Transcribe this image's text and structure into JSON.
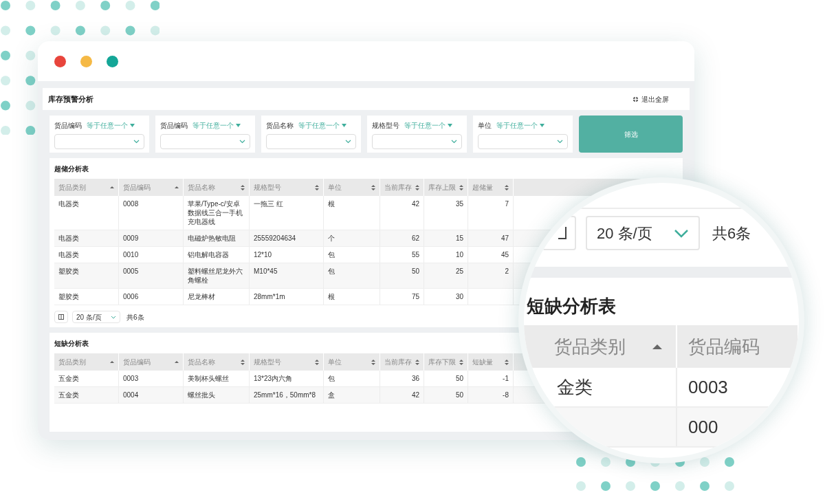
{
  "window": {
    "title": "库存预警分析",
    "exit_fullscreen": "退出全屏"
  },
  "filters": [
    {
      "label": "货品编码",
      "operator": "等于任意一个"
    },
    {
      "label": "货品编码",
      "operator": "等于任意一个"
    },
    {
      "label": "货品名称",
      "operator": "等于任意一个"
    },
    {
      "label": "规格型号",
      "operator": "等于任意一个"
    },
    {
      "label": "单位",
      "operator": "等于任意一个"
    }
  ],
  "filter_button": "筛选",
  "overstock": {
    "title": "超储分析表",
    "columns": [
      {
        "label": "货品类别",
        "sort_ascending": true,
        "kind": "text"
      },
      {
        "label": "货品编码",
        "sort_ascending": true,
        "kind": "text"
      },
      {
        "label": "货品名称",
        "sort_ascending": false,
        "kind": "text"
      },
      {
        "label": "规格型号",
        "sort_ascending": false,
        "kind": "text"
      },
      {
        "label": "单位",
        "sort_ascending": false,
        "kind": "text"
      },
      {
        "label": "当前库存",
        "sort_ascending": false,
        "kind": "number"
      },
      {
        "label": "库存上限",
        "sort_ascending": false,
        "kind": "number"
      },
      {
        "label": "超储量",
        "sort_ascending": false,
        "kind": "number"
      }
    ],
    "rows": [
      [
        "电器类",
        "0008",
        "苹果/Type-c/安卓数据线三合一手机充电器线",
        "一拖三 红",
        "根",
        "42",
        "35",
        "7"
      ],
      [
        "电器类",
        "0009",
        "电磁炉热敏电阻",
        "25559204634",
        "个",
        "62",
        "15",
        "47"
      ],
      [
        "电器类",
        "0010",
        "铝电解电容器",
        "12*10",
        "包",
        "55",
        "10",
        "45"
      ],
      [
        "塑胶类",
        "0005",
        "塑料螺丝尼龙外六角螺栓",
        "M10*45",
        "包",
        "50",
        "25",
        "2"
      ],
      [
        "塑胶类",
        "0006",
        "尼龙棒材",
        "28mm*1m",
        "根",
        "75",
        "30",
        null
      ]
    ],
    "pagination": {
      "page_size": "20 条/页",
      "total": "共6条"
    }
  },
  "shortage": {
    "title": "短缺分析表",
    "columns": [
      {
        "label": "货品类别",
        "sort_ascending": true,
        "kind": "text"
      },
      {
        "label": "货品编码",
        "sort_ascending": true,
        "kind": "text"
      },
      {
        "label": "货品名称",
        "sort_ascending": false,
        "kind": "text"
      },
      {
        "label": "规格型号",
        "sort_ascending": false,
        "kind": "text"
      },
      {
        "label": "单位",
        "sort_ascending": false,
        "kind": "text"
      },
      {
        "label": "当前库存",
        "sort_ascending": false,
        "kind": "number"
      },
      {
        "label": "库存下限",
        "sort_ascending": false,
        "kind": "number"
      },
      {
        "label": "短缺量",
        "sort_ascending": false,
        "kind": "number"
      }
    ],
    "rows": [
      [
        "五金类",
        "0003",
        "美制杯头螺丝",
        "13*23内六角",
        "包",
        "36",
        "50",
        "-1"
      ],
      [
        "五金类",
        "0004",
        "螺丝批头",
        "25mm*16，50mm*8",
        "盒",
        "42",
        "50",
        "-8"
      ]
    ]
  },
  "magnifier": {
    "page_size": "20 条/页",
    "total": "共6条",
    "title": "短缺分析表",
    "columns": [
      {
        "label": "货品类别",
        "sort_ascending": true
      },
      {
        "label": "货品编码"
      }
    ],
    "rows": [
      [
        "金类",
        "0003"
      ],
      [
        "",
        "000"
      ]
    ]
  }
}
